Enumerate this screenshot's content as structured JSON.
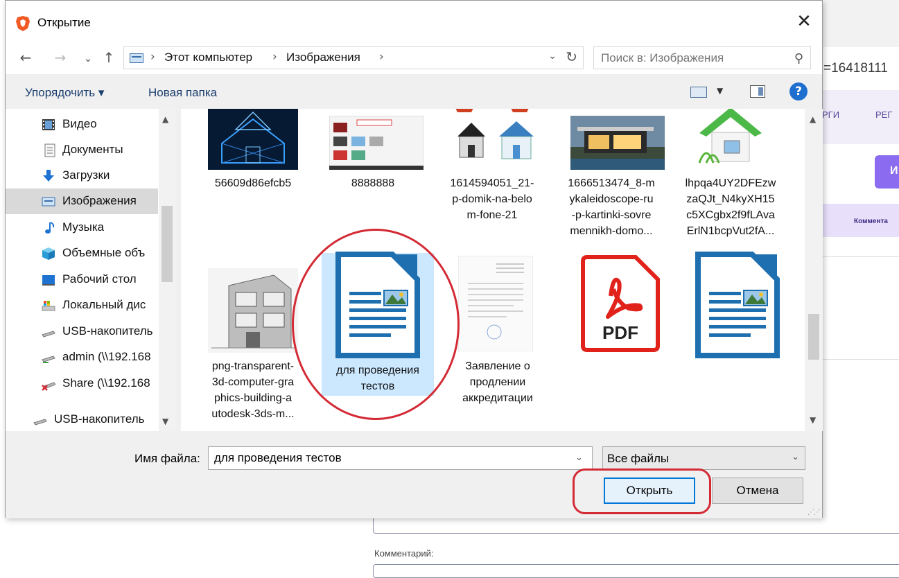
{
  "background": {
    "url_fragment": "=16418111",
    "nav_item_1": "РГИ",
    "nav_item_2": "РЕГ",
    "purple_button": "И",
    "tab_label": "Коммента",
    "comment_label": "Комментарий:"
  },
  "dialog": {
    "title": "Открытие",
    "close_glyph": "✕",
    "nav": {
      "back": "←",
      "forward": "→",
      "recent": "⌄",
      "up": "↑"
    },
    "breadcrumb": [
      "Этот компьютер",
      "Изображения"
    ],
    "breadcrumb_sep": "›",
    "addr_dropdown": "⌄",
    "refresh_glyph": "↻",
    "search_placeholder": "Поиск в: Изображения",
    "search_glyph": "⚲",
    "toolbar": {
      "organize": "Упорядочить ▾",
      "new_folder": "Новая папка",
      "help": "?"
    },
    "sidebar": [
      {
        "label": "Видео",
        "icon": "video-icon"
      },
      {
        "label": "Документы",
        "icon": "documents-icon"
      },
      {
        "label": "Загрузки",
        "icon": "downloads-icon"
      },
      {
        "label": "Изображения",
        "icon": "pictures-icon",
        "selected": true
      },
      {
        "label": "Музыка",
        "icon": "music-icon"
      },
      {
        "label": "Объемные объ",
        "icon": "3d-objects-icon"
      },
      {
        "label": "Рабочий стол",
        "icon": "desktop-icon"
      },
      {
        "label": "Локальный дис",
        "icon": "local-disk-icon"
      },
      {
        "label": "USB-накопитель",
        "icon": "usb-drive-icon"
      },
      {
        "label": "admin (\\\\192.168",
        "icon": "network-drive-icon"
      },
      {
        "label": "Share (\\\\192.168",
        "icon": "network-drive-disconnected-icon"
      },
      {
        "label": "USB-накопитель",
        "icon": "usb-drive-icon"
      }
    ],
    "files_row1": [
      {
        "name": [
          "56609d86efcb5"
        ],
        "thumb": "house-wireframe-image"
      },
      {
        "name": [
          "8888888"
        ],
        "thumb": "screenshot-image"
      },
      {
        "name": [
          "1614594051_21-",
          "p-domik-na-belo",
          "m-fone-21"
        ],
        "thumb": "houses-image"
      },
      {
        "name": [
          "1666513474_8-m",
          "ykaleidoscope-ru",
          "-p-kartinki-sovre",
          "mennikh-domo..."
        ],
        "thumb": "modern-house-image"
      },
      {
        "name": [
          "lhpqa4UY2DFEzw",
          "zaQJt_N4kyXH15",
          "c5XCgbx2f9fLAva",
          "ErlN1bcpVut2fA..."
        ],
        "thumb": "green-house-icon-image"
      }
    ],
    "files_row2": [
      {
        "name": [
          "png-transparent-",
          "3d-computer-gra",
          "phics-building-a",
          "utodesk-3ds-m..."
        ],
        "thumb": "building-render-image"
      },
      {
        "name": [
          "для проведения",
          "тестов"
        ],
        "thumb": "libreoffice-draw-file-icon",
        "selected": true
      },
      {
        "name": [
          "Заявление о",
          "продлении",
          "аккредитации"
        ],
        "thumb": "scanned-document-image"
      },
      {
        "name": [
          ""
        ],
        "thumb": "pdf-file-icon",
        "pdf_text": "PDF"
      },
      {
        "name": [
          ""
        ],
        "thumb": "libreoffice-draw-file-icon"
      }
    ],
    "file_name_label": "Имя файла:",
    "file_name_value": "для проведения тестов",
    "filter_label": "Все файлы",
    "open_button": "Открыть",
    "cancel_button": "Отмена"
  },
  "colors": {
    "annotation": "#d42a35",
    "accent": "#0078d7",
    "selection": "#cce8ff"
  }
}
